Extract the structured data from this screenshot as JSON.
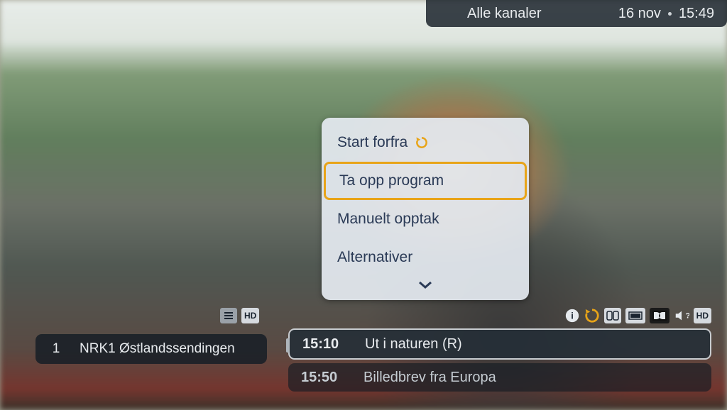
{
  "top": {
    "group": "Alle kanaler",
    "date": "16 nov",
    "time": "15:49"
  },
  "menu": {
    "items": [
      {
        "label": "Start forfra",
        "has_restart_icon": true
      },
      {
        "label": "Ta opp program",
        "selected": true
      },
      {
        "label": "Manuelt opptak"
      },
      {
        "label": "Alternativer"
      }
    ]
  },
  "channel": {
    "number": "1",
    "name": "NRK1 Østlandssendingen"
  },
  "badges": {
    "hd": "HD"
  },
  "programs": {
    "current": {
      "time": "15:10",
      "title": "Ut i naturen (R)"
    },
    "next": {
      "time": "15:50",
      "title": "Billedbrev fra Europa"
    }
  }
}
